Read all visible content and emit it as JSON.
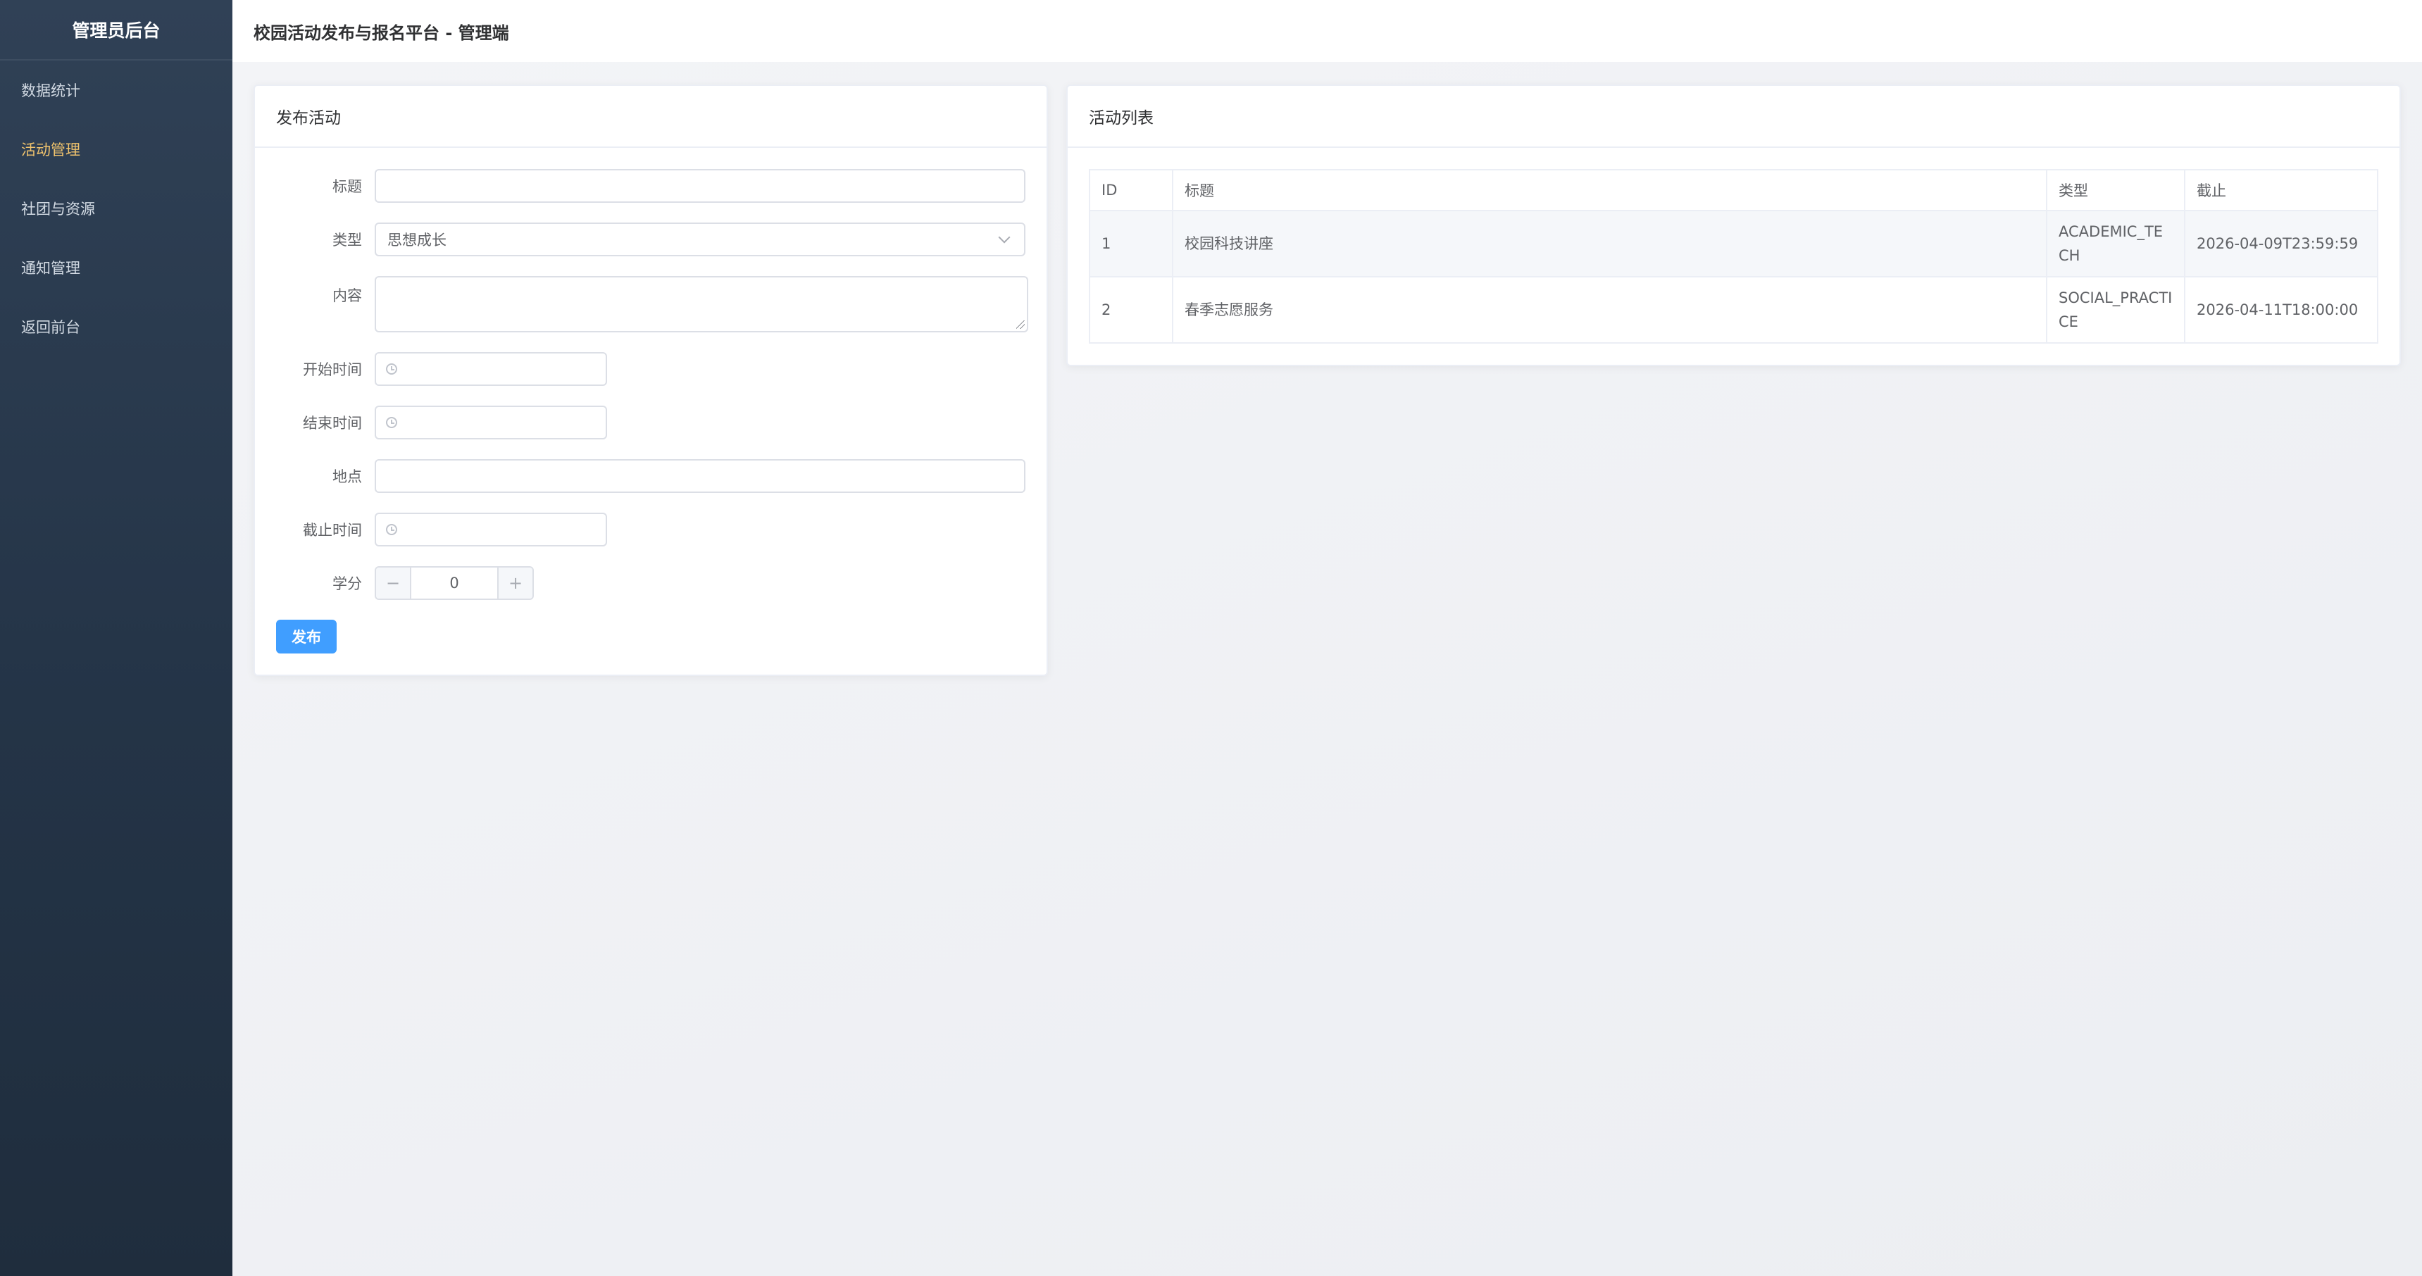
{
  "sidebar": {
    "title": "管理员后台",
    "items": [
      {
        "label": "数据统计",
        "active": false
      },
      {
        "label": "活动管理",
        "active": true
      },
      {
        "label": "社团与资源",
        "active": false
      },
      {
        "label": "通知管理",
        "active": false
      },
      {
        "label": "返回前台",
        "active": false
      }
    ]
  },
  "header": {
    "title": "校园活动发布与报名平台 - 管理端"
  },
  "form": {
    "title": "发布活动",
    "fields": {
      "title_label": "标题",
      "type_label": "类型",
      "type_value": "思想成长",
      "content_label": "内容",
      "start_label": "开始时间",
      "end_label": "结束时间",
      "location_label": "地点",
      "deadline_label": "截止时间",
      "credit_label": "学分",
      "credit_value": "0"
    },
    "submit_label": "发布"
  },
  "list": {
    "title": "活动列表",
    "columns": [
      "ID",
      "标题",
      "类型",
      "截止"
    ],
    "rows": [
      {
        "id": "1",
        "title": "校园科技讲座",
        "type": "ACADEMIC_TECH",
        "deadline": "2026-04-09T23:59:59"
      },
      {
        "id": "2",
        "title": "春季志愿服务",
        "type": "SOCIAL_PRACTICE",
        "deadline": "2026-04-11T18:00:00"
      }
    ]
  },
  "colors": {
    "sidebar_bg": "#304156",
    "active_nav": "#f0c36d",
    "primary": "#409eff"
  }
}
